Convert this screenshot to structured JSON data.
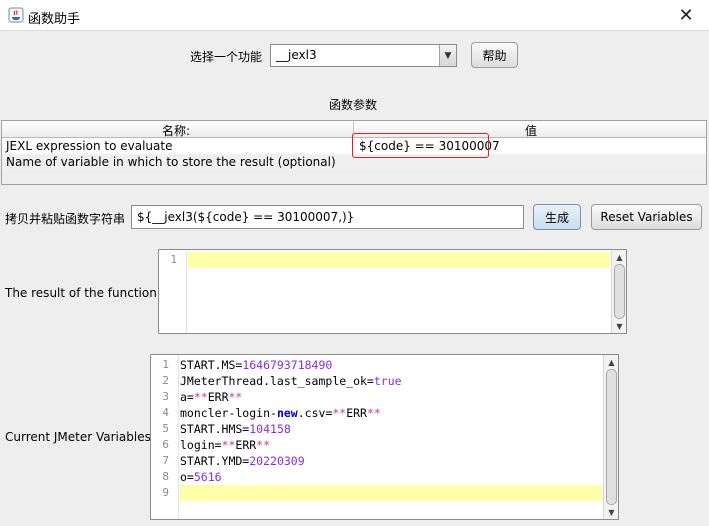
{
  "window": {
    "title": "函数助手",
    "close_glyph": "✕"
  },
  "selector": {
    "label": "选择一个功能",
    "value": "__jexl3",
    "help_button": "帮助"
  },
  "params": {
    "section_title": "函数参数",
    "columns": [
      "名称:",
      "值"
    ],
    "rows": [
      {
        "name": "JEXL expression to evaluate",
        "value": "${code} == 30100007"
      },
      {
        "name": "Name of variable in which to store the result (optional)",
        "value": ""
      }
    ]
  },
  "copy": {
    "label": "拷贝并粘贴函数字符串",
    "value": "${__jexl3(${code} == 30100007,)}",
    "generate_button": "生成",
    "reset_button": "Reset Variables"
  },
  "result": {
    "label": "The result of the function is",
    "line_numbers": [
      "1"
    ],
    "content": ""
  },
  "variables": {
    "label": "Current JMeter Variables",
    "lines": [
      {
        "n": "1",
        "key": "START.MS=",
        "val": "1646793718490",
        "kind": "num"
      },
      {
        "n": "2",
        "key": "JMeterThread.last_sample_ok=",
        "val": "true",
        "kind": "num"
      },
      {
        "n": "3",
        "key": "a=",
        "val": "**ERR**",
        "kind": "err"
      },
      {
        "n": "4",
        "key": "moncler-login-new.csv=",
        "val": "**ERR**",
        "kind": "err"
      },
      {
        "n": "5",
        "key": "START.HMS=",
        "val": "104158",
        "kind": "num"
      },
      {
        "n": "6",
        "key": "login=",
        "val": "**ERR**",
        "kind": "err"
      },
      {
        "n": "7",
        "key": "START.YMD=",
        "val": "20220309",
        "kind": "num"
      },
      {
        "n": "8",
        "key": "o=",
        "val": "5616",
        "kind": "num"
      },
      {
        "n": "9",
        "key": "",
        "val": "",
        "kind": "empty"
      }
    ]
  },
  "icons": {
    "app": "java-app-icon",
    "close": "close-icon",
    "combo_arrow": "chevron-down-icon"
  },
  "colors": {
    "highlight_border": "#e02020",
    "current_line": "#ffffaa",
    "number": "#8a2be2",
    "keyword": "#0000cc"
  }
}
